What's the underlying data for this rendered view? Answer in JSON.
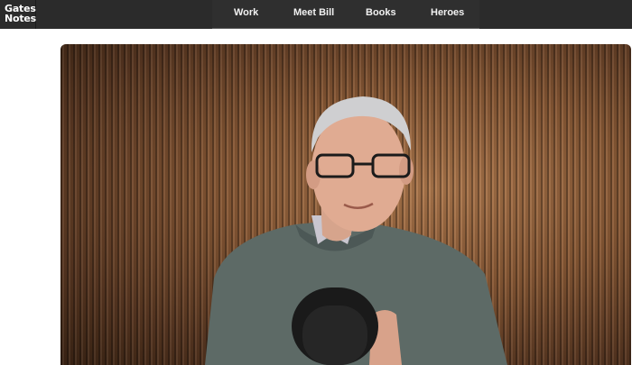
{
  "logo": {
    "line1": "Gates",
    "line2": "Notes"
  },
  "nav": {
    "items": [
      "Work",
      "Meet Bill",
      "Books",
      "Heroes"
    ]
  },
  "hero": {
    "image_subject": "portrait-photo",
    "colors": {
      "wall": "#8a5a36",
      "sweater": "#5d6a66",
      "mic": "#1a1a1a"
    }
  }
}
